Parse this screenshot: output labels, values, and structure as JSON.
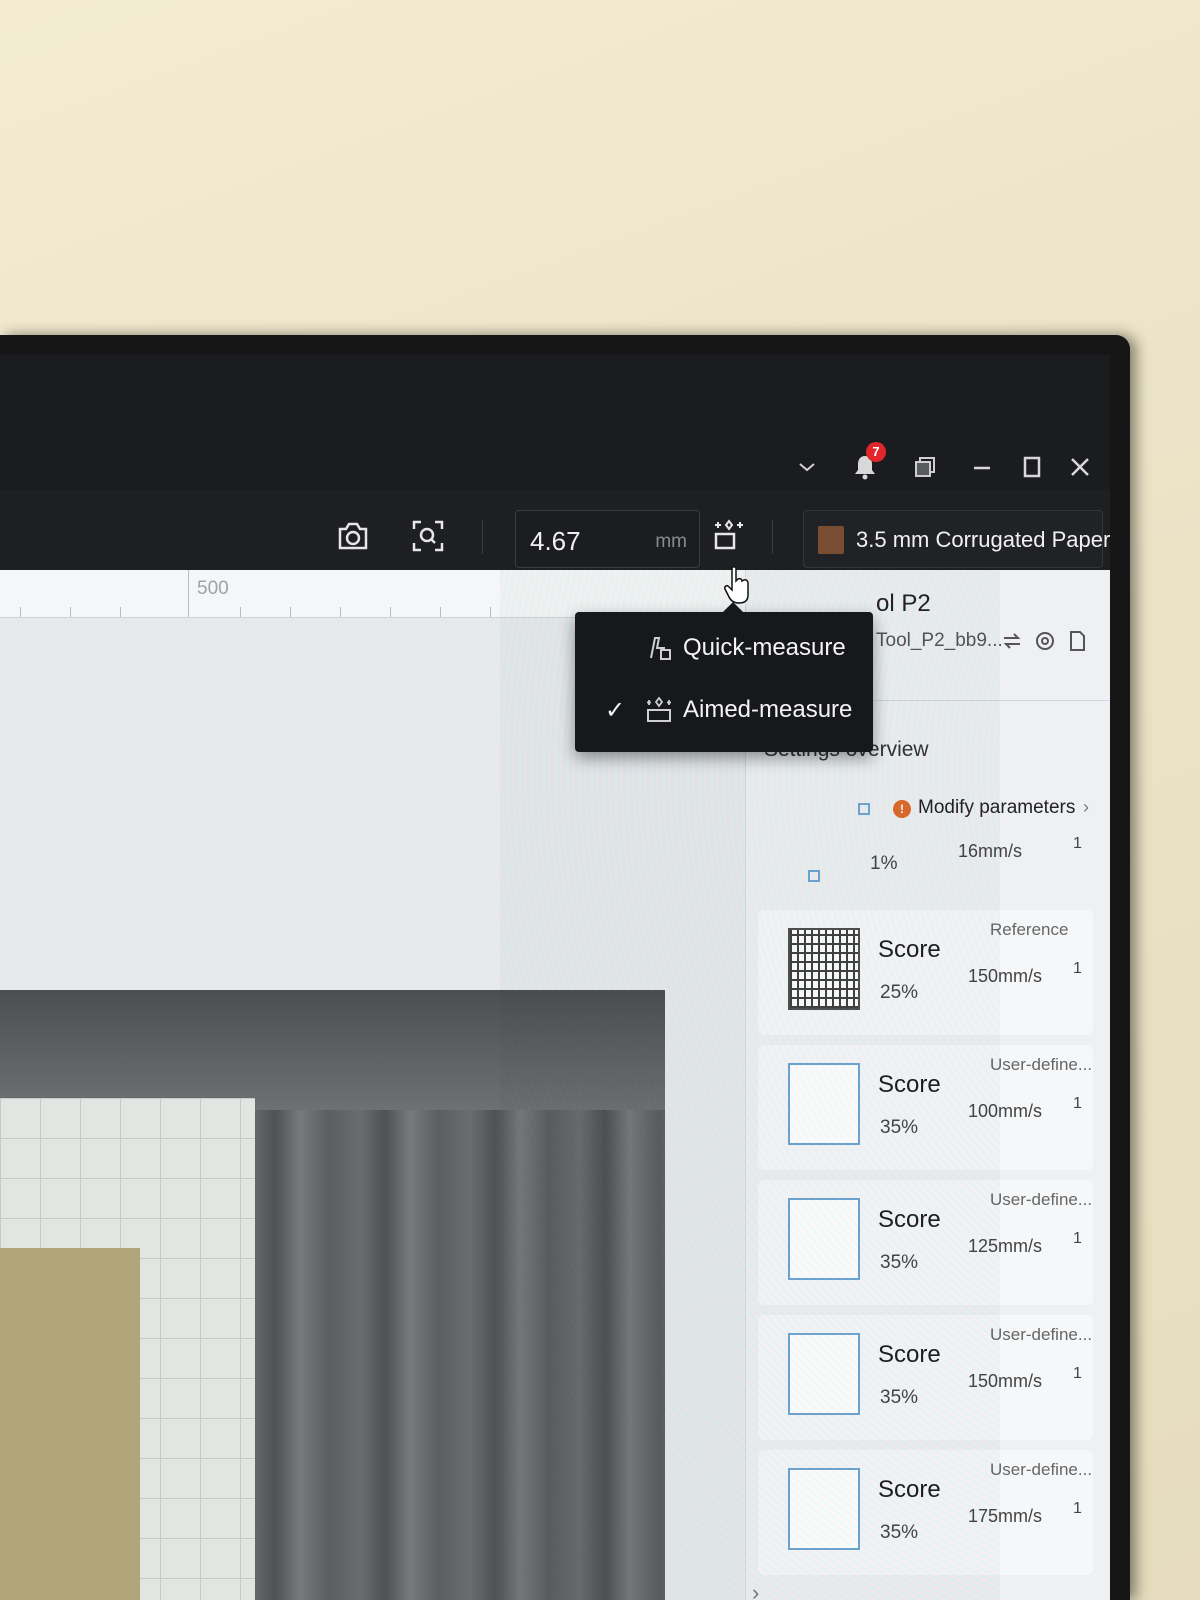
{
  "titlebar": {
    "notification_count": "7",
    "icons": [
      "chevron-down-icon",
      "bell-icon",
      "window-stack-icon",
      "minimize-icon",
      "maximize-icon",
      "close-icon"
    ]
  },
  "toolbar": {
    "icons": [
      "camera-icon",
      "focus-icon",
      "measure-icon"
    ],
    "thickness_value": "4.67",
    "thickness_unit": "mm",
    "material": {
      "name": "3.5 mm Corrugated Paper",
      "swatch_color": "#7a4e33"
    }
  },
  "ruler": {
    "label": "500"
  },
  "measure_menu": {
    "items": [
      {
        "label": "Quick-measure",
        "checked": false,
        "icon": "quick-measure-icon"
      },
      {
        "label": "Aimed-measure",
        "checked": true,
        "icon": "aimed-measure-icon"
      }
    ],
    "check_glyph": "✓"
  },
  "device": {
    "name_fragment": "ol P2",
    "id_fragment": "Tool_P2_bb9...",
    "icons": [
      "swap-icon",
      "settings-icon",
      "document-icon"
    ]
  },
  "settings_overview": {
    "title": "Settings overview",
    "modify": {
      "label": "Modify parameters",
      "warning": "!",
      "power": "1%",
      "speed": "16mm/s",
      "passes": "1",
      "chevron": "›"
    },
    "layers": [
      {
        "process": "Score",
        "power": "25%",
        "speed": "150mm/s",
        "passes": "1",
        "source": "Reference",
        "thumb": "pattern"
      },
      {
        "process": "Score",
        "power": "35%",
        "speed": "100mm/s",
        "passes": "1",
        "source": "User-define...",
        "thumb": "empty"
      },
      {
        "process": "Score",
        "power": "35%",
        "speed": "125mm/s",
        "passes": "1",
        "source": "User-define...",
        "thumb": "empty"
      },
      {
        "process": "Score",
        "power": "35%",
        "speed": "150mm/s",
        "passes": "1",
        "source": "User-define...",
        "thumb": "empty"
      },
      {
        "process": "Score",
        "power": "35%",
        "speed": "175mm/s",
        "passes": "1",
        "source": "User-define...",
        "thumb": "empty"
      }
    ],
    "collapse_glyph": "›"
  },
  "colors": {
    "accent_outline": "#6fa6d4",
    "warning": "#e06a2c",
    "badge": "#e3262b"
  }
}
